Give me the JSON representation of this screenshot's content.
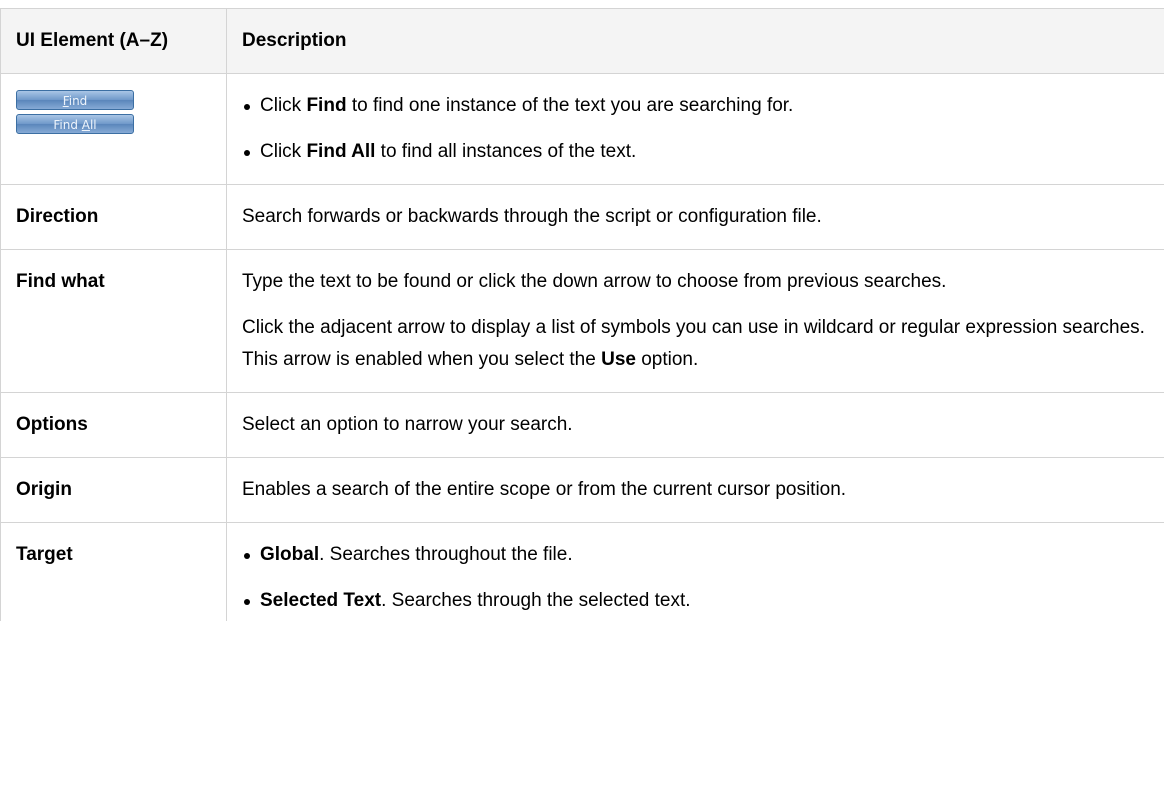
{
  "table": {
    "headers": [
      "UI Element (A–Z)",
      "Description"
    ],
    "buttons": {
      "find": {
        "prefix": "",
        "accel": "F",
        "suffix": "ind"
      },
      "find_all": {
        "prefix": "Find ",
        "accel": "A",
        "suffix": "ll"
      }
    },
    "rows": {
      "buttons_row": {
        "bullet1": {
          "pre": "Click ",
          "bold": "Find",
          "post": " to find one instance of the text you are searching for."
        },
        "bullet2": {
          "pre": "Click ",
          "bold": "Find All",
          "post": " to find all instances of the text."
        }
      },
      "direction": {
        "name": "Direction",
        "desc": "Search forwards or backwards through the script or configuration file."
      },
      "find_what": {
        "name": "Find what",
        "p1": "Type the text to be found or click the down arrow to choose from previous searches.",
        "p2_pre": "Click the adjacent arrow to display a list of symbols you can use in wildcard or regular expression searches. This arrow is enabled when you select the ",
        "p2_bold": "Use",
        "p2_post": " option."
      },
      "options": {
        "name": "Options",
        "desc": "Select an option to narrow your search."
      },
      "origin": {
        "name": "Origin",
        "desc": "Enables a search of the entire scope or from the current cursor position."
      },
      "target": {
        "name": "Target",
        "bullet1": {
          "bold": "Global",
          "post": ". Searches throughout the file."
        },
        "bullet2": {
          "bold": "Selected Text",
          "post": ". Searches through the selected text."
        }
      }
    }
  }
}
